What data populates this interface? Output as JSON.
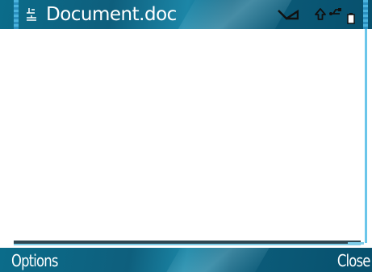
{
  "title_bar": {
    "document_title": "Document.doc",
    "icons": {
      "app": "document-editor-icon",
      "signal": "signal-icon",
      "upload": "upload-arrow-icon",
      "usb": "usb-connection-icon",
      "battery": "battery-icon"
    }
  },
  "softkeys": {
    "left_label": "Options",
    "right_label": "Close"
  },
  "colors": {
    "bar_dark": "#07506d",
    "bar_mid": "#0e5f7d",
    "bar_highlight": "#1c86a7",
    "scroll_accent": "#6ac6ea",
    "text": "#ffffff"
  }
}
